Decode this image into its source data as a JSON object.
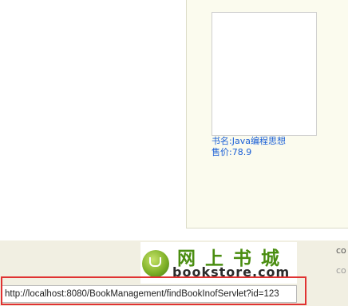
{
  "book": {
    "title": "书名:Java编程思想",
    "price": "售价:78.9"
  },
  "footer": {
    "logo_cn": "网上书城",
    "logo_en": "bookstore.com",
    "right_text_1": "co",
    "right_text_2": "co"
  },
  "status_bar": {
    "url": "http://localhost:8080/BookManagement/findBookInofServlet?id=123"
  },
  "colors": {
    "panel_bg": "#fbfbee",
    "footer_bg": "#f1efe2",
    "link": "#1a5fd6",
    "logo_green": "#4a8d10",
    "highlight": "#e03232"
  }
}
